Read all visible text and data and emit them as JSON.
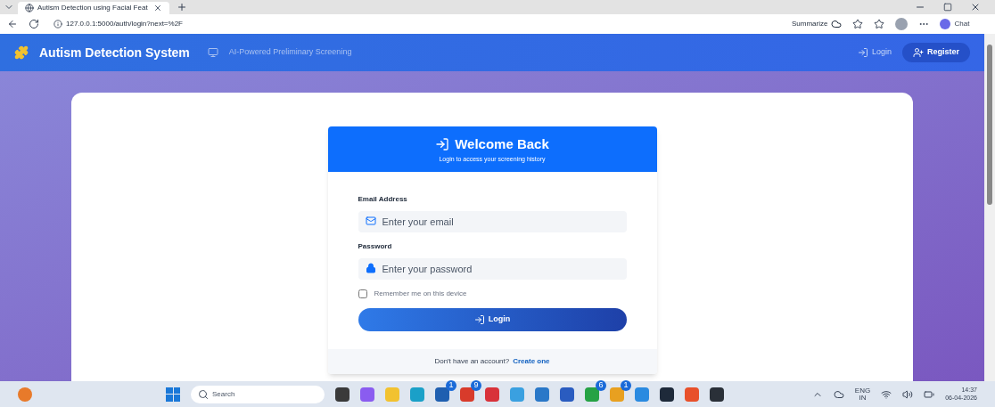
{
  "browser": {
    "tab_title": "Autism Detection using Facial Feat",
    "address": "127.0.0.1:5000/auth/login?next=%2F",
    "summarize_label": "Summarize",
    "chat_label": "Chat"
  },
  "navbar": {
    "brand": "Autism Detection System",
    "tagline": "AI-Powered Preliminary Screening",
    "login_link": "Login",
    "register_button": "Register"
  },
  "login": {
    "title": "Welcome Back",
    "subtitle": "Login to access your screening history",
    "fields": [
      {
        "kind": "email",
        "label": "Email Address",
        "placeholder": "Enter your email"
      },
      {
        "kind": "password",
        "label": "Password",
        "placeholder": "Enter your password"
      }
    ],
    "remember": {
      "label": "Remember me on this device",
      "checked": false
    },
    "submit": "Login",
    "footer_text": "Don't have an account?",
    "footer_link": "Create one"
  },
  "taskbar": {
    "search_placeholder": "Search",
    "apps": [
      {
        "color": "#3a3a3a"
      },
      {
        "color": "#8a5cf0"
      },
      {
        "color": "#f2c230"
      },
      {
        "color": "#1aa0c8"
      },
      {
        "color": "#1f5fb0",
        "badge": "1"
      },
      {
        "color": "#d83b2b",
        "badge": "9"
      },
      {
        "color": "#d8323a"
      },
      {
        "color": "#3aa0e0"
      },
      {
        "color": "#2a78c8"
      },
      {
        "color": "#2a5cc0"
      },
      {
        "color": "#25a244",
        "badge": "6"
      },
      {
        "color": "#e8a020",
        "badge": "1"
      },
      {
        "color": "#2a8ae0"
      },
      {
        "color": "#1e2a3a"
      },
      {
        "color": "#e8502a"
      },
      {
        "color": "#2a3038"
      }
    ],
    "lang": "ENG",
    "region": "IN",
    "time": "14:37",
    "date": "06-04-2026"
  }
}
